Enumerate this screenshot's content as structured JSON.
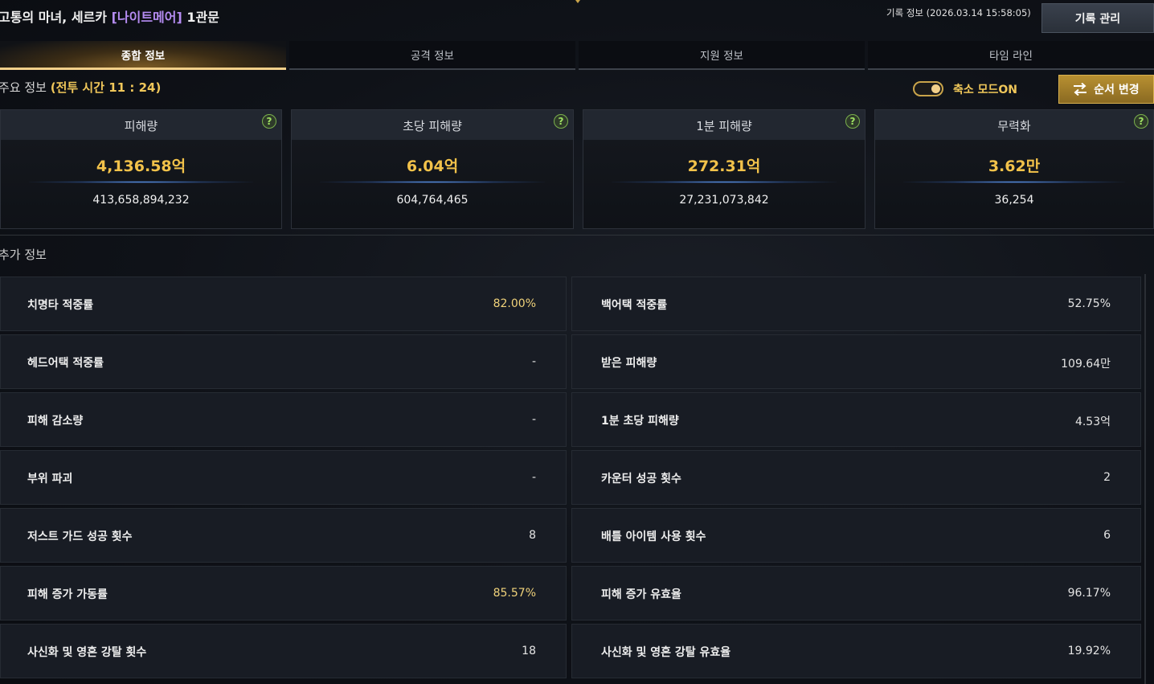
{
  "header": {
    "raid_title_prefix": "고통의 마녀, 세르카 ",
    "raid_title_tag": "[나이트메어]",
    "raid_title_suffix": " 1관문",
    "record_info": "기록 정보 (2026.03.14 15:58:05)",
    "manage_button": "기록 관리"
  },
  "tabs": [
    {
      "label": "종합 정보",
      "active": true
    },
    {
      "label": "공격 정보",
      "active": false
    },
    {
      "label": "지원 정보",
      "active": false
    },
    {
      "label": "타임 라인",
      "active": false
    }
  ],
  "main_info": {
    "label": "주요 정보 ",
    "battle_time": "(전투 시간 11 : 24)",
    "toggle_label": "축소 모드ON",
    "toggle_on": true,
    "order_button": "순서 변경"
  },
  "cards": [
    {
      "name": "피해량",
      "big": "4,136.58억",
      "exact": "413,658,894,232",
      "help": "?"
    },
    {
      "name": "초당 피해량",
      "big": "6.04억",
      "exact": "604,764,465",
      "help": "?"
    },
    {
      "name": "1분 피해량",
      "big": "272.31억",
      "exact": "27,231,073,842",
      "help": "?"
    },
    {
      "name": "무력화",
      "big": "3.62만",
      "exact": "36,254",
      "help": "?"
    }
  ],
  "extra_info": {
    "label": "추가 정보",
    "left": [
      {
        "label": "치명타 적중률",
        "value": "82.00%"
      },
      {
        "label": "헤드어택 적중률",
        "value": "-"
      },
      {
        "label": "피해 감소량",
        "value": "-"
      },
      {
        "label": "부위 파괴",
        "value": "-"
      },
      {
        "label": "저스트 가드 성공 횟수",
        "value": "8"
      },
      {
        "label": "피해 증가 가동률",
        "value": "85.57%"
      },
      {
        "label": "사신화 및 영혼 강탈 횟수",
        "value": "18"
      }
    ],
    "right": [
      {
        "label": "백어택 적중률",
        "value": "52.75%"
      },
      {
        "label": "받은 피해량",
        "value": "109.64만"
      },
      {
        "label": "1분 초당 피해량",
        "value": "4.53억"
      },
      {
        "label": "카운터 성공 횟수",
        "value": "2"
      },
      {
        "label": "배틀 아이템 사용 횟수",
        "value": "6"
      },
      {
        "label": "피해 증가 유효율",
        "value": "96.17%"
      },
      {
        "label": "사신화 및 영혼 강탈 유효율",
        "value": "19.92%"
      }
    ]
  },
  "colors": {
    "accent_gold": "#f2c24a",
    "tag_purple": "#b58cf2",
    "help_green": "#9ee062"
  }
}
